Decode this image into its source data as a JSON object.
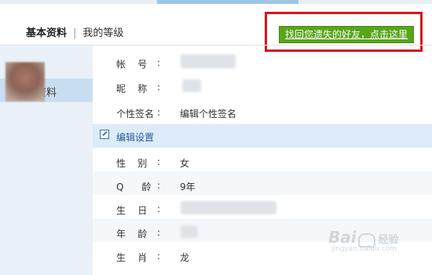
{
  "tabs": {
    "active": "基本资料",
    "separator": "|",
    "other": "我的等级"
  },
  "recover_button": "找回您遗失的好友，点击这里",
  "profile": {
    "account": {
      "label": "帐    号",
      "colon": ":"
    },
    "nickname": {
      "label": "昵    称",
      "colon": ":"
    },
    "signature": {
      "label": "个性签名",
      "colon": ":",
      "value": "编辑个性签名"
    }
  },
  "sidebar": {
    "items": [
      {
        "label": "基本资料"
      }
    ]
  },
  "edit_settings": "编辑设置",
  "details": {
    "gender": {
      "label": "性    别",
      "colon": ":",
      "value": "女"
    },
    "q_age": {
      "label": "Q      龄",
      "colon": ":",
      "value": "9年"
    },
    "birthday": {
      "label": "生    日",
      "colon": ":"
    },
    "age": {
      "label": "年    龄",
      "colon": ":"
    },
    "zodiac": {
      "label": "生    肖",
      "colon": ":",
      "value": "龙"
    }
  },
  "watermark": {
    "brand": "Bai",
    "suffix": "经验",
    "url": "jingyan.baidu.com"
  },
  "colors": {
    "accent_green": "#58a51a",
    "highlight_red": "#d8141b",
    "sidebar_bg": "#eaf1f8",
    "selected_bg": "#c9dff1",
    "link_blue": "#2b5b9c"
  },
  "icons": {
    "edit": "edit-icon"
  }
}
